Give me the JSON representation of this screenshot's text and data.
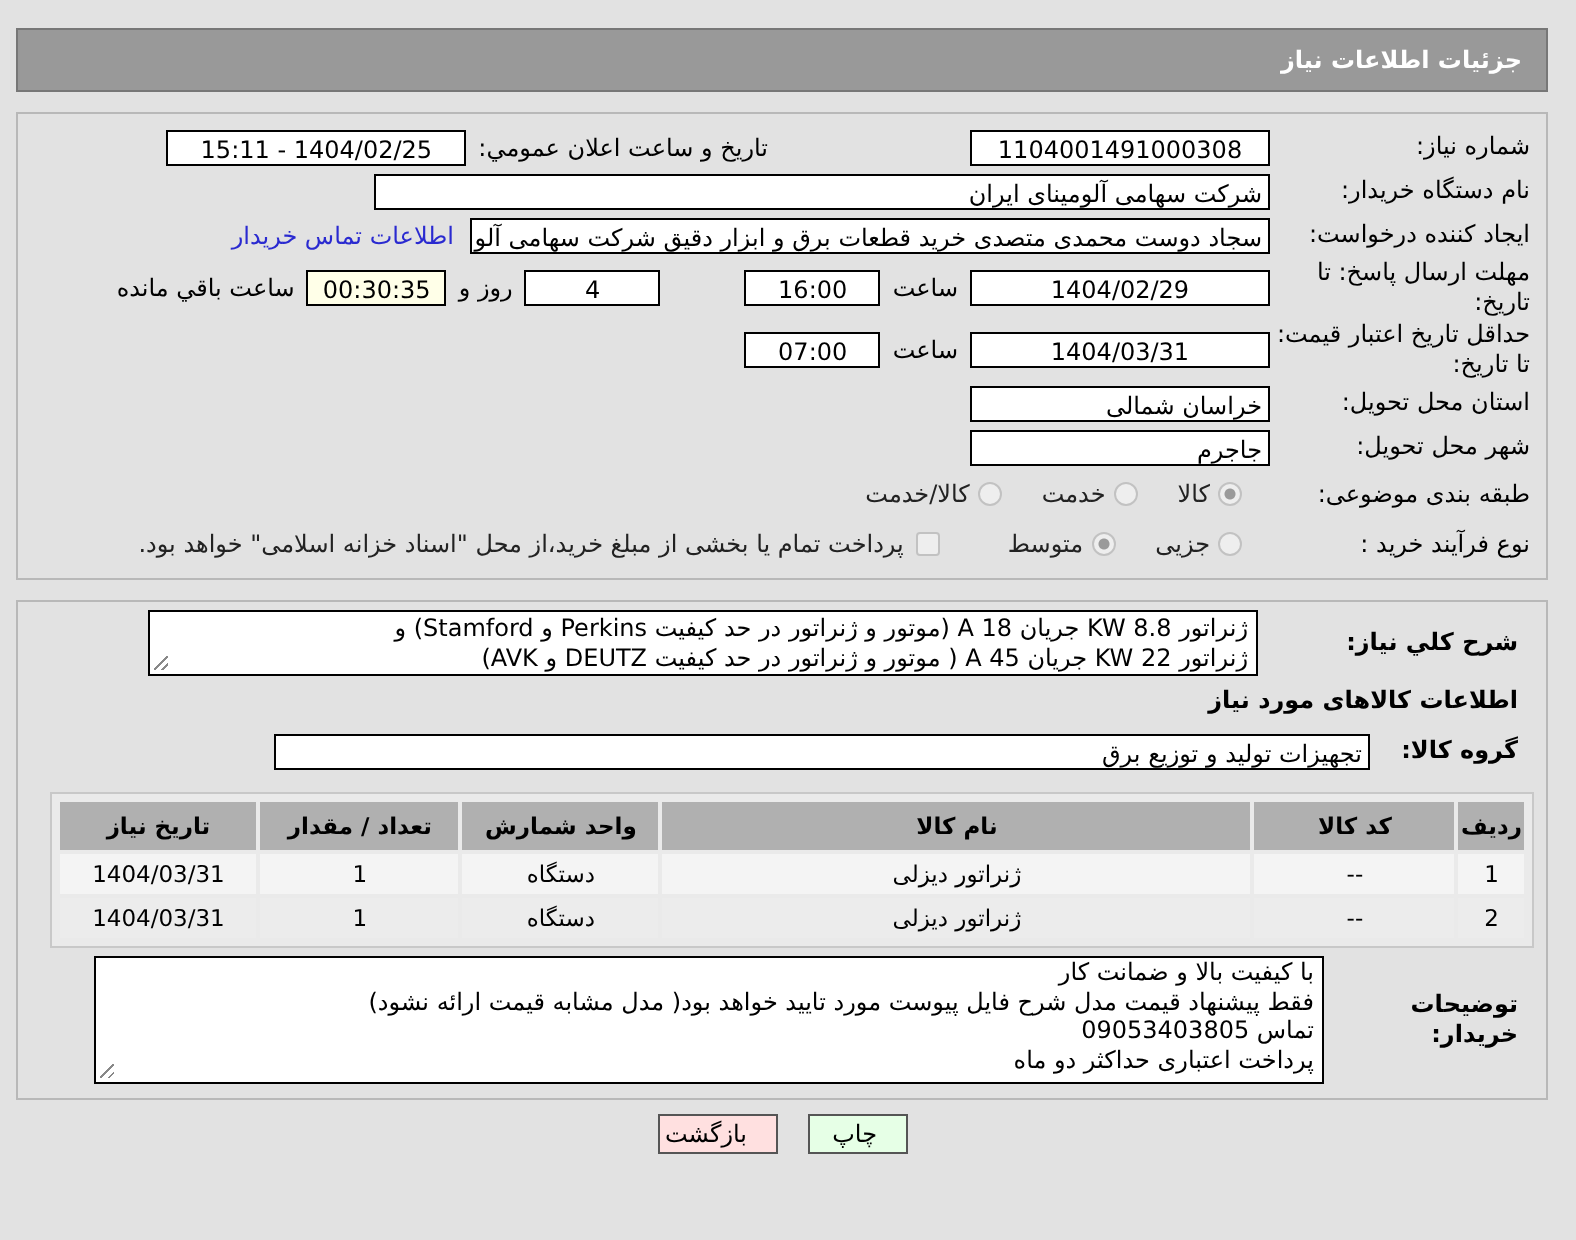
{
  "header": {
    "title": "جزئیات اطلاعات نیاز"
  },
  "need_number": {
    "label": "شماره نیاز:",
    "value": "1104001491000308"
  },
  "announce": {
    "label": "تاریخ و ساعت اعلان عمومي:",
    "value": "1404/02/25 - 15:11"
  },
  "buyer": {
    "label": "نام دستگاه خریدار:",
    "value": "شرکت سهامی آلومینای ایران"
  },
  "requester": {
    "label": "ایجاد کننده درخواست:",
    "value": "سجاد دوست محمدی متصدی خرید قطعات برق و ابزار دقیق شرکت سهامی آلو",
    "link": "اطلاعات تماس خریدار"
  },
  "deadline": {
    "label": "مهلت ارسال پاسخ: تا تاریخ:",
    "date": "1404/02/29",
    "time_label": "ساعت",
    "time": "16:00",
    "days": "4",
    "days_label": "روز و",
    "remaining": "00:30:35",
    "remaining_label": "ساعت باقي مانده"
  },
  "validity": {
    "label": "حداقل تاریخ اعتبار قیمت: تا تاریخ:",
    "date": "1404/03/31",
    "time_label": "ساعت",
    "time": "07:00"
  },
  "province": {
    "label": "استان محل تحویل:",
    "value": "خراسان شمالی"
  },
  "city": {
    "label": "شهر محل تحویل:",
    "value": "جاجرم"
  },
  "category": {
    "label": "طبقه بندی موضوعی:",
    "options": [
      {
        "label": "کالا",
        "selected": true
      },
      {
        "label": "خدمت",
        "selected": false
      },
      {
        "label": "کالا/خدمت",
        "selected": false
      }
    ]
  },
  "process": {
    "label": "نوع فرآیند خرید :",
    "options": [
      {
        "label": "جزیی",
        "selected": false
      },
      {
        "label": "متوسط",
        "selected": true
      }
    ],
    "payment": {
      "label": "پرداخت تمام یا بخشی از مبلغ خرید،از محل \"اسناد خزانه اسلامی\" خواهد بود.",
      "checked": false
    }
  },
  "description": {
    "label": "شرح کلي نياز:",
    "lines": [
      "ژنراتور KW 8.8 جریان A 18 (موتور و ژنراتور در حد کیفیت Perkins و Stamford) و",
      "ژنراتور KW 22 جریان A 45 ( موتور و ژنراتور در حد کیفیت DEUTZ و AVK)"
    ]
  },
  "goods_title": "اطلاعات کالاهای مورد نیاز",
  "goods_group": {
    "label": "گروه کالا:",
    "value": "تجهیزات تولید و توزیع برق"
  },
  "table": {
    "columns": [
      "ردیف",
      "کد کالا",
      "نام کالا",
      "واحد شمارش",
      "تعداد / مقدار",
      "تاریخ نیاز"
    ],
    "rows": [
      [
        "1",
        "--",
        "ژنراتور دیزلی",
        "دستگاه",
        "1",
        "1404/03/31"
      ],
      [
        "2",
        "--",
        "ژنراتور دیزلی",
        "دستگاه",
        "1",
        "1404/03/31"
      ]
    ]
  },
  "buyer_notes": {
    "label": "توضیحات خریدار:",
    "lines": [
      "با کیفیت بالا و ضمانت کار",
      "فقط پیشنهاد قیمت مدل شرح فایل پیوست مورد تایید خواهد بود( مدل مشابه قیمت ارائه نشود)",
      "تماس 09053403805",
      "پرداخت اعتباری حداکثر دو ماه"
    ]
  },
  "buttons": [
    {
      "label": "چاپ",
      "kind": "print"
    },
    {
      "label": "بازگشت",
      "kind": "back"
    }
  ]
}
